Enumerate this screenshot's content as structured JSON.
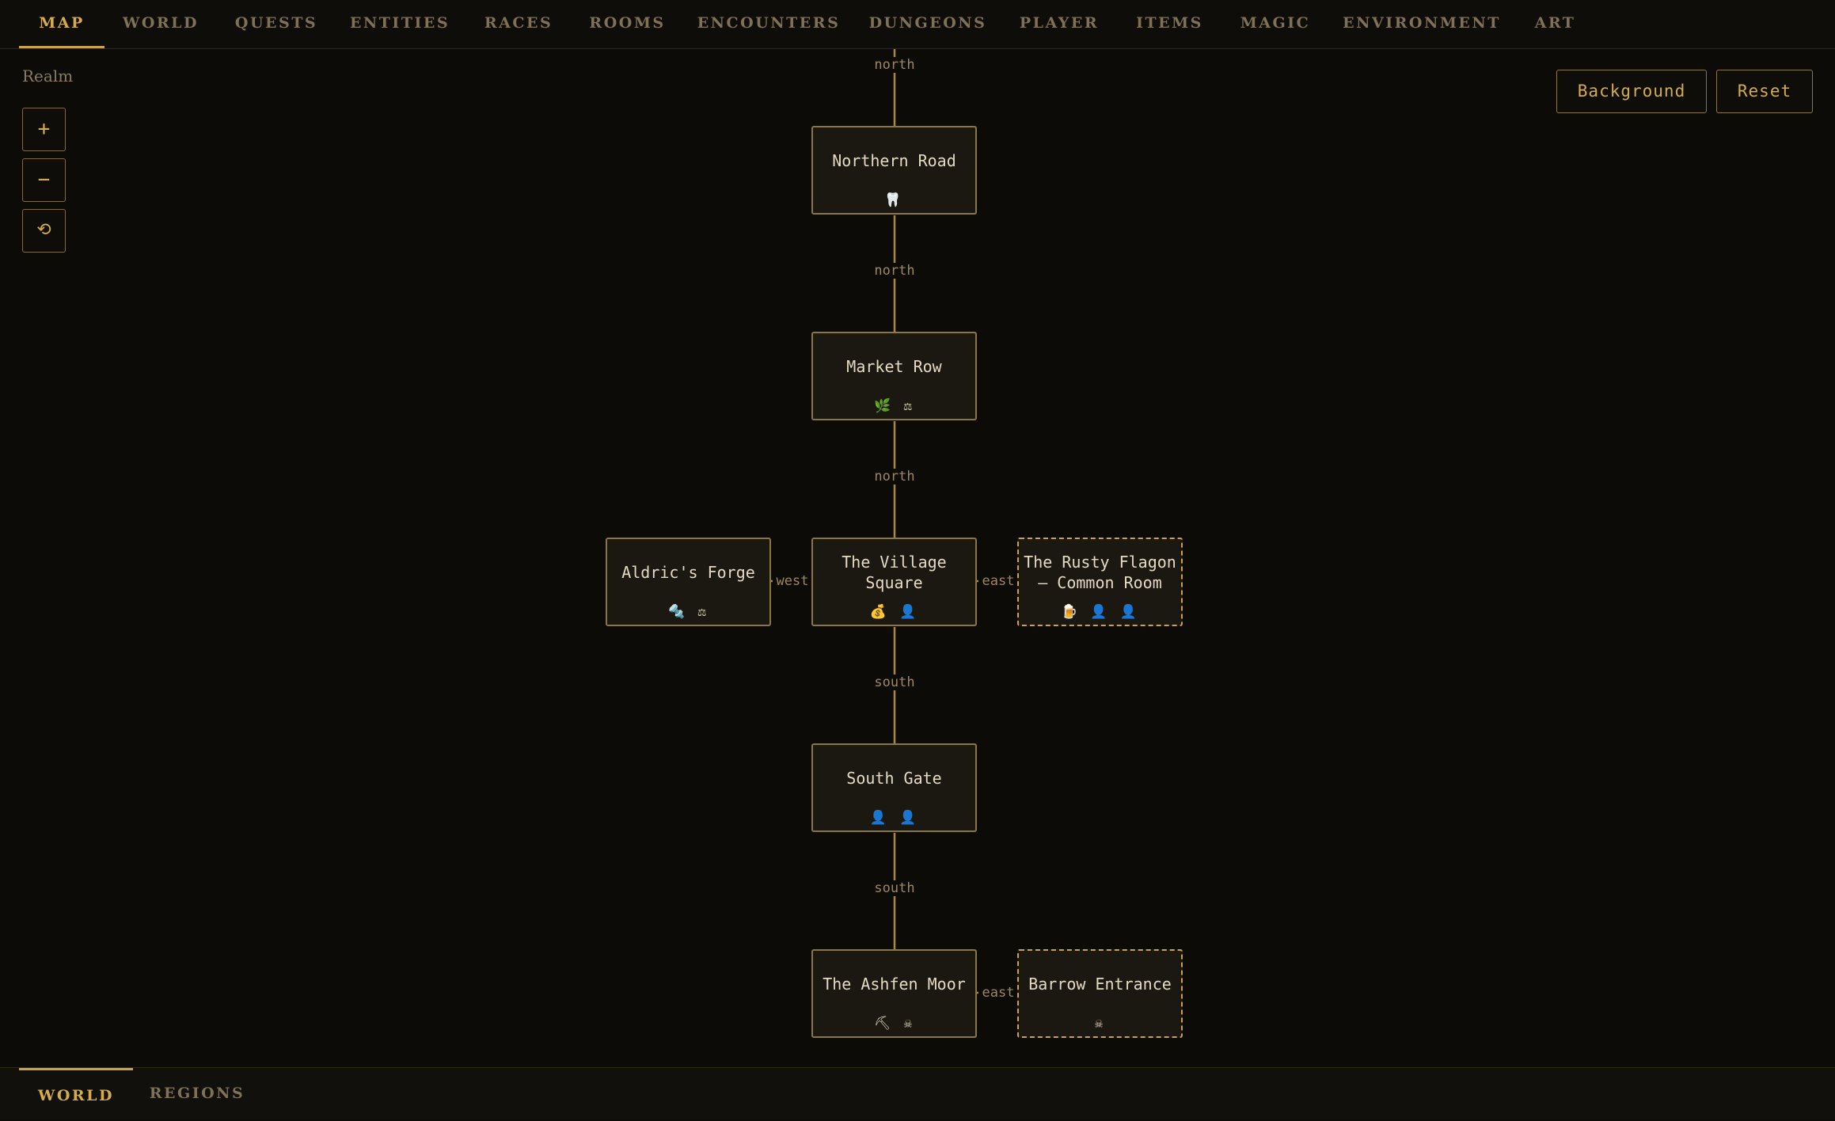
{
  "top_tabs": [
    {
      "label": "MAP"
    },
    {
      "label": "WORLD"
    },
    {
      "label": "QUESTS"
    },
    {
      "label": "ENTITIES"
    },
    {
      "label": "RACES"
    },
    {
      "label": "ROOMS"
    },
    {
      "label": "ENCOUNTERS"
    },
    {
      "label": "DUNGEONS"
    },
    {
      "label": "PLAYER"
    },
    {
      "label": "ITEMS"
    },
    {
      "label": "MAGIC"
    },
    {
      "label": "ENVIRONMENT"
    },
    {
      "label": "ART"
    }
  ],
  "active_top_tab": "MAP",
  "bottom_tabs": [
    {
      "label": "WORLD"
    },
    {
      "label": "REGIONS"
    }
  ],
  "active_bottom_tab": "WORLD",
  "sidebar": {
    "realm_label": "Realm",
    "zoom_in": "+",
    "zoom_out": "−",
    "reset_view": "⟲"
  },
  "actions": {
    "background": "Background",
    "reset": "Reset"
  },
  "rooms": [
    {
      "id": "northern-road",
      "name": "Northern Road",
      "icons": "🦷",
      "dashed": false
    },
    {
      "id": "market-row",
      "name": "Market Row",
      "icons": "🌿 ⚖",
      "dashed": false
    },
    {
      "id": "aldrics-forge",
      "name": "Aldric's Forge",
      "icons": "🔩 ⚖",
      "dashed": false
    },
    {
      "id": "village-square",
      "name": "The Village Square",
      "icons": "💰 👤",
      "dashed": false
    },
    {
      "id": "rusty-flagon",
      "name": "The Rusty Flagon — Common Room",
      "icons": "🍺 👤 👤",
      "dashed": true
    },
    {
      "id": "south-gate",
      "name": "South Gate",
      "icons": "👤 👤",
      "dashed": false
    },
    {
      "id": "ashfen-moor",
      "name": "The Ashfen Moor",
      "icons": "⛏ ☠",
      "dashed": false
    },
    {
      "id": "barrow-entrance",
      "name": "Barrow Entrance",
      "icons": "☠",
      "dashed": true
    }
  ],
  "links": [
    {
      "label": "north"
    },
    {
      "label": "north"
    },
    {
      "label": "north"
    },
    {
      "label": "west"
    },
    {
      "label": "east"
    },
    {
      "label": "south"
    },
    {
      "label": "south"
    },
    {
      "label": "east"
    }
  ],
  "colors": {
    "accent": "#c9a24a",
    "link_line": "#a8883e",
    "background": "#0d0b08"
  }
}
